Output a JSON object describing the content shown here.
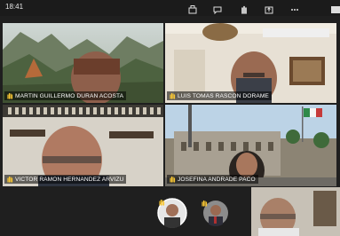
{
  "status_bar": {
    "time": "18:41"
  },
  "toolbar": {
    "icons": [
      "reactions-icon",
      "chat-icon",
      "raise-hand-icon",
      "share-icon",
      "more-icon"
    ]
  },
  "participants": [
    {
      "name": "MARTIN GUILLERMO DURAN ACOSTA",
      "hand_raised": true
    },
    {
      "name": "LUIS TOMAS RASCON DORAME",
      "hand_raised": true
    },
    {
      "name": "VICTOR RAMON HERNANDEZ ARVIZU",
      "hand_raised": true
    },
    {
      "name": "JOSEFINA ANDRADE PACO",
      "hand_raised": true
    }
  ],
  "bottom_row": {
    "avatars": 2
  },
  "colors": {
    "hand": "#f7c634",
    "bg": "#1f1f1f"
  }
}
